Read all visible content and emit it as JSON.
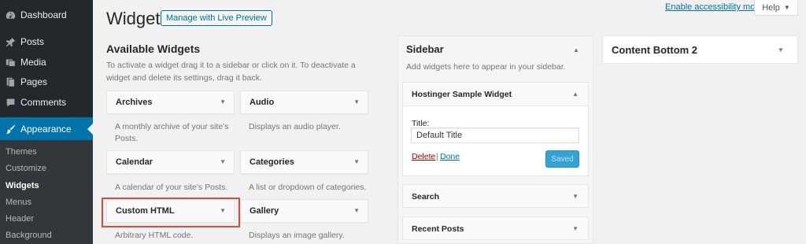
{
  "admin_menu": {
    "items": [
      {
        "label": "Dashboard",
        "icon": "dashboard-icon"
      },
      {
        "label": "Posts",
        "icon": "pin-icon"
      },
      {
        "label": "Media",
        "icon": "media-icon"
      },
      {
        "label": "Pages",
        "icon": "pages-icon"
      },
      {
        "label": "Comments",
        "icon": "comments-icon"
      },
      {
        "label": "Appearance",
        "icon": "brush-icon"
      }
    ],
    "submenu": [
      "Themes",
      "Customize",
      "Widgets",
      "Menus",
      "Header",
      "Background"
    ],
    "active_submenu": "Widgets"
  },
  "header": {
    "title": "Widgets",
    "live_preview_button": "Manage with Live Preview",
    "accessibility_link": "Enable accessibility mode",
    "help_label": "Help"
  },
  "available": {
    "title": "Available Widgets",
    "description": "To activate a widget drag it to a sidebar or click on it. To deactivate a widget and delete its settings, drag it back.",
    "widgets": [
      {
        "title": "Archives",
        "desc": "A monthly archive of your site's Posts."
      },
      {
        "title": "Audio",
        "desc": "Displays an audio player."
      },
      {
        "title": "Calendar",
        "desc": "A calendar of your site's Posts."
      },
      {
        "title": "Categories",
        "desc": "A list or dropdown of categories."
      },
      {
        "title": "Custom HTML",
        "desc": "Arbitrary HTML code."
      },
      {
        "title": "Gallery",
        "desc": "Displays an image gallery."
      }
    ]
  },
  "sidebar": {
    "title": "Sidebar",
    "description": "Add widgets here to appear in your sidebar.",
    "open_widget": {
      "title": "Hostinger Sample Widget",
      "field_label": "Title:",
      "field_value": "Default Title",
      "delete_label": "Delete",
      "separator": "|",
      "done_label": "Done",
      "saved_label": "Saved"
    },
    "widgets": [
      "Search",
      "Recent Posts"
    ]
  },
  "content_bottom": {
    "title": "Content Bottom 2"
  },
  "colors": {
    "admin_bg": "#23282d",
    "accent": "#0073aa",
    "highlight_border": "#e0483c"
  }
}
